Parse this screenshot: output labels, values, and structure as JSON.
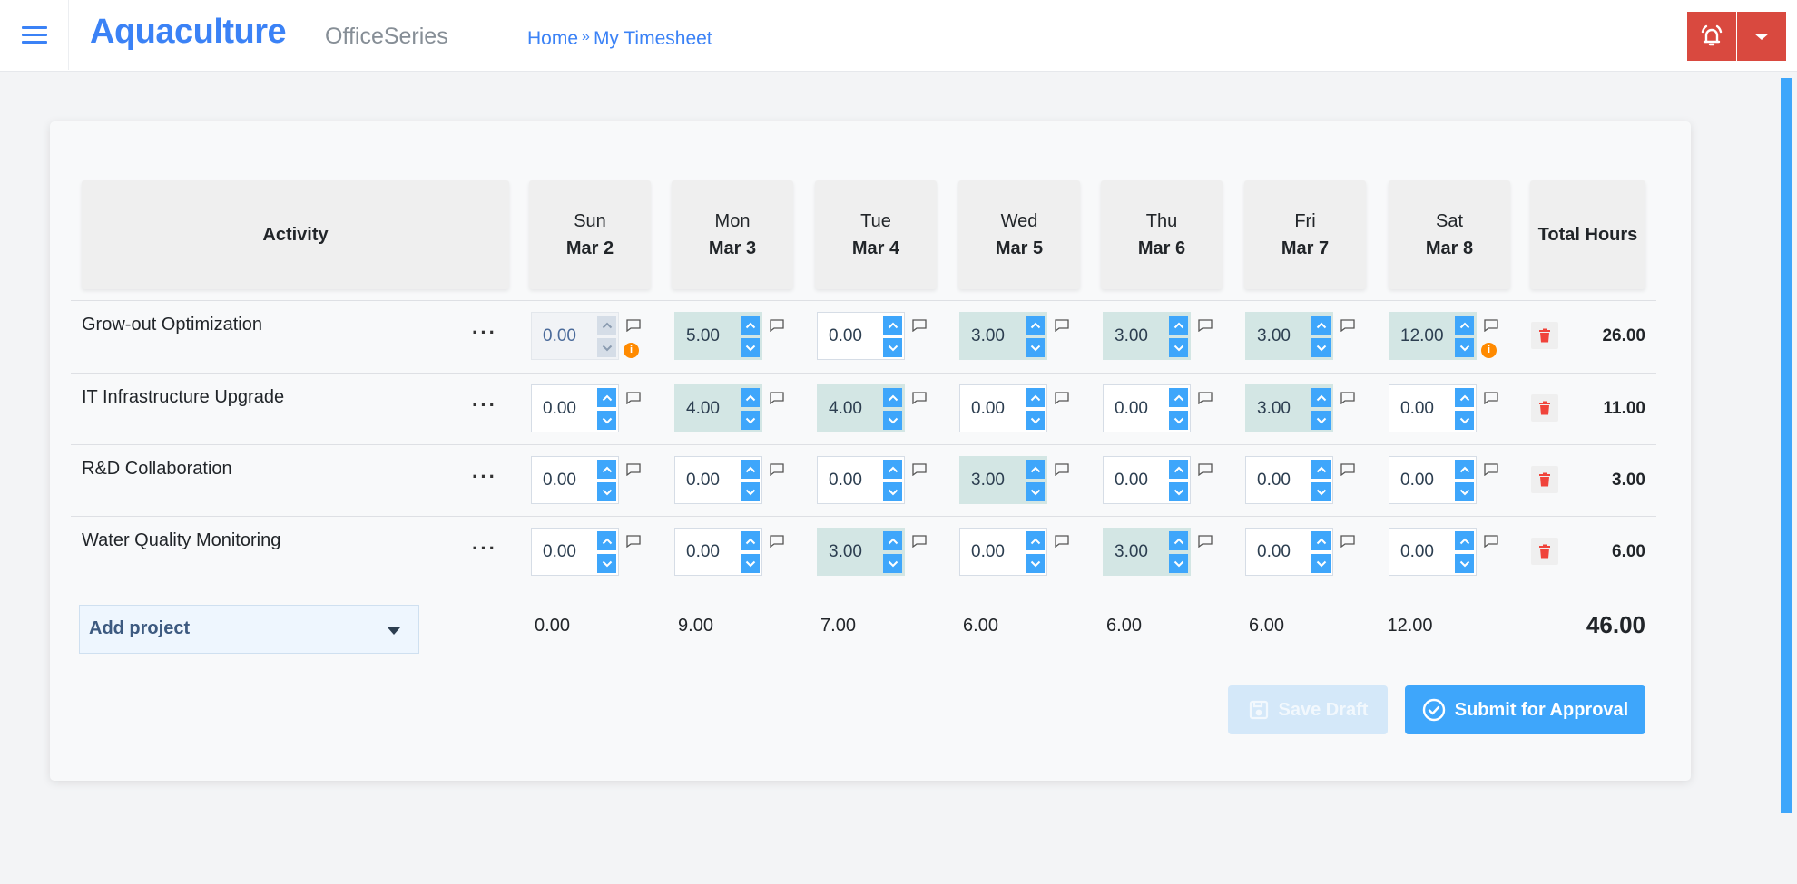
{
  "header": {
    "brand": "Aquaculture",
    "suite": "OfficeSeries",
    "breadcrumb": [
      {
        "label": "Home"
      },
      {
        "label": "My Timesheet"
      }
    ],
    "breadcrumb_separator": "»",
    "icons": {
      "menu": "hamburger-icon",
      "notifications": "bell-icon",
      "dropdown": "caret-down-icon"
    },
    "accent_color": "#3b82f6",
    "alert_color": "#d9493f"
  },
  "table": {
    "activity_header": "Activity",
    "total_header": "Total Hours",
    "days": [
      {
        "day": "Sun",
        "date": "Mar 2"
      },
      {
        "day": "Mon",
        "date": "Mar 3"
      },
      {
        "day": "Tue",
        "date": "Mar 4"
      },
      {
        "day": "Wed",
        "date": "Mar 5"
      },
      {
        "day": "Thu",
        "date": "Mar 6"
      },
      {
        "day": "Fri",
        "date": "Mar 7"
      },
      {
        "day": "Sat",
        "date": "Mar 8"
      }
    ],
    "rows": [
      {
        "activity": "Grow-out Optimization",
        "hours": [
          "0.00",
          "5.00",
          "0.00",
          "3.00",
          "3.00",
          "3.00",
          "12.00"
        ],
        "total": "26.00",
        "disabled_days": [
          0
        ],
        "info_days": [
          0,
          6
        ]
      },
      {
        "activity": "IT Infrastructure Upgrade",
        "hours": [
          "0.00",
          "4.00",
          "4.00",
          "0.00",
          "0.00",
          "3.00",
          "0.00"
        ],
        "total": "11.00",
        "disabled_days": [],
        "info_days": []
      },
      {
        "activity": "R&D Collaboration",
        "hours": [
          "0.00",
          "0.00",
          "0.00",
          "3.00",
          "0.00",
          "0.00",
          "0.00"
        ],
        "total": "3.00",
        "disabled_days": [],
        "info_days": []
      },
      {
        "activity": "Water Quality Monitoring",
        "hours": [
          "0.00",
          "0.00",
          "3.00",
          "0.00",
          "3.00",
          "0.00",
          "0.00"
        ],
        "total": "6.00",
        "disabled_days": [],
        "info_days": []
      }
    ],
    "more_label": "···",
    "footer": {
      "add_project_label": "Add project",
      "day_totals": [
        "0.00",
        "9.00",
        "7.00",
        "6.00",
        "6.00",
        "6.00",
        "12.00"
      ],
      "grand_total": "46.00"
    }
  },
  "actions": {
    "save_draft": "Save Draft",
    "submit": "Submit for Approval",
    "submit_color": "#3ea6fb"
  }
}
